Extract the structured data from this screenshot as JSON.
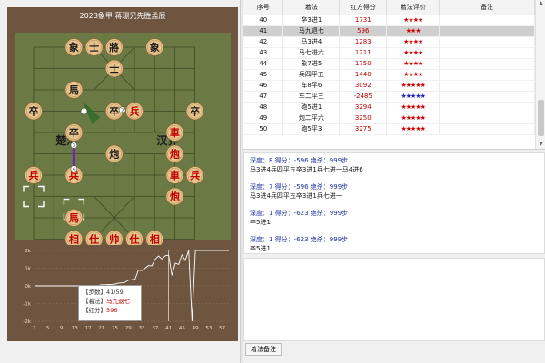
{
  "board": {
    "title": "2023象甲 蒋璟兄先胜孟辰",
    "overlay_texts": [
      "楚河",
      "汉界"
    ],
    "pieces": [
      {
        "ch": "象",
        "side": "black",
        "col": 2,
        "row": 0
      },
      {
        "ch": "士",
        "side": "black",
        "col": 3,
        "row": 0
      },
      {
        "ch": "將",
        "side": "black",
        "col": 4,
        "row": 0
      },
      {
        "ch": "象",
        "side": "black",
        "col": 6,
        "row": 0
      },
      {
        "ch": "士",
        "side": "black",
        "col": 4,
        "row": 1
      },
      {
        "ch": "馬",
        "side": "black",
        "col": 2,
        "row": 2
      },
      {
        "ch": "卒",
        "side": "black",
        "col": 0,
        "row": 3
      },
      {
        "ch": "卒",
        "side": "black",
        "col": 4,
        "row": 3
      },
      {
        "ch": "兵",
        "side": "red",
        "col": 5,
        "row": 3
      },
      {
        "ch": "卒",
        "side": "black",
        "col": 8,
        "row": 3
      },
      {
        "ch": "卒",
        "side": "black",
        "col": 2,
        "row": 4
      },
      {
        "ch": "車",
        "side": "red",
        "col": 7,
        "row": 4
      },
      {
        "ch": "炮",
        "side": "black",
        "col": 4,
        "row": 5
      },
      {
        "ch": "炮",
        "side": "red",
        "col": 7,
        "row": 5
      },
      {
        "ch": "兵",
        "side": "red",
        "col": 0,
        "row": 6
      },
      {
        "ch": "兵",
        "side": "red",
        "col": 2,
        "row": 6
      },
      {
        "ch": "車",
        "side": "red",
        "col": 7,
        "row": 6
      },
      {
        "ch": "兵",
        "side": "red",
        "col": 8,
        "row": 6
      },
      {
        "ch": "炮",
        "side": "red",
        "col": 7,
        "row": 7
      },
      {
        "ch": "馬",
        "side": "red",
        "col": 2,
        "row": 8
      },
      {
        "ch": "相",
        "side": "red",
        "col": 2,
        "row": 9
      },
      {
        "ch": "仕",
        "side": "red",
        "col": 3,
        "row": 9
      },
      {
        "ch": "帅",
        "side": "red",
        "col": 4,
        "row": 9
      },
      {
        "ch": "仕",
        "side": "red",
        "col": 5,
        "row": 9
      },
      {
        "ch": "相",
        "side": "red",
        "col": 6,
        "row": 9
      }
    ],
    "markers": [
      {
        "label": "1",
        "col": 2.5,
        "row": 3
      },
      {
        "label": "2",
        "col": 4.4,
        "row": 2.95
      },
      {
        "label": "3",
        "col": 2,
        "row": 4.6
      },
      {
        "label": "4",
        "col": 2,
        "row": 5.7
      }
    ]
  },
  "chart_data": {
    "type": "line",
    "ylim": [
      -2000,
      2000
    ],
    "yticks": [
      "2k",
      "1k",
      "0k",
      "-1k",
      "-2k"
    ],
    "xticks": [
      1,
      5,
      9,
      13,
      17,
      21,
      25,
      29,
      33,
      37,
      41,
      45,
      49,
      53,
      57
    ],
    "series": [
      {
        "values": [
          0,
          0,
          0,
          0,
          0,
          0,
          0,
          0,
          0,
          0,
          0,
          0,
          0,
          0,
          0,
          0,
          0,
          30,
          30,
          30,
          60,
          60,
          80,
          80,
          100,
          150,
          170,
          200,
          320,
          350,
          380,
          900,
          860,
          1000,
          1150,
          1130,
          1500,
          1690,
          1520,
          1700,
          1731,
          596,
          1283,
          1211,
          1750,
          1440,
          3092,
          -2485,
          3294,
          3250,
          3275,
          3100,
          3300,
          3500,
          3600,
          3800,
          4000,
          4100,
          4200
        ]
      }
    ]
  },
  "tooltip": {
    "step_label": "【步数】",
    "step_value": "41/59",
    "move_label": "【着法】",
    "move_value": "马九退七",
    "score_label": "【红分】",
    "score_value": "596"
  },
  "table": {
    "headers": [
      "序号",
      "着法",
      "红方得分",
      "着法评价",
      "备注"
    ],
    "rows": [
      {
        "no": "40",
        "move": "卒3进1",
        "score": "1731",
        "stars": "★★★★",
        "color": "red"
      },
      {
        "no": "41",
        "move": "马九退七",
        "score": "596",
        "stars": "★★★",
        "color": "red",
        "selected": true
      },
      {
        "no": "42",
        "move": "马3进4",
        "score": "1283",
        "stars": "★★★★",
        "color": "red"
      },
      {
        "no": "43",
        "move": "马七进六",
        "score": "1211",
        "stars": "★★★★",
        "color": "red"
      },
      {
        "no": "44",
        "move": "象7进5",
        "score": "1750",
        "stars": "★★★★",
        "color": "red"
      },
      {
        "no": "45",
        "move": "兵四平五",
        "score": "1440",
        "stars": "★★★★",
        "color": "red"
      },
      {
        "no": "46",
        "move": "车8平6",
        "score": "3092",
        "stars": "★★★★★",
        "color": "red"
      },
      {
        "no": "47",
        "move": "车二平三",
        "score": "-2485",
        "stars": "★★★★★",
        "color": "blue"
      },
      {
        "no": "48",
        "move": "砲5进1",
        "score": "3294",
        "stars": "★★★★★",
        "color": "red"
      },
      {
        "no": "49",
        "move": "炮二平六",
        "score": "3250",
        "stars": "★★★★★",
        "color": "red"
      },
      {
        "no": "50",
        "move": "砲5平3",
        "score": "3275",
        "stars": "★★★★★",
        "color": "red"
      }
    ]
  },
  "analysis": [
    {
      "head": "深度：8   得分：-596   绝杀：999步",
      "line": "马3进4兵四平五卒3进1兵七进一马4进6"
    },
    {
      "head": "深度：7   得分：-596   绝杀：999步",
      "line": "马3进4兵四平五卒3进1兵七进一"
    },
    {
      "head": "深度：1   得分：-623   绝杀：999步",
      "line": "卒5进1"
    },
    {
      "head": "深度：1   得分：-623   绝杀：999步",
      "line": "卒5进1"
    }
  ],
  "notes": {
    "tab_label": "着法备注"
  },
  "colors": {
    "board": "#6b7a44",
    "panel": "#6e5540",
    "piece": "#e8c48c",
    "red_text": "#c00000",
    "black_text": "#1a1a1a",
    "chart_line": "#ffffff"
  }
}
